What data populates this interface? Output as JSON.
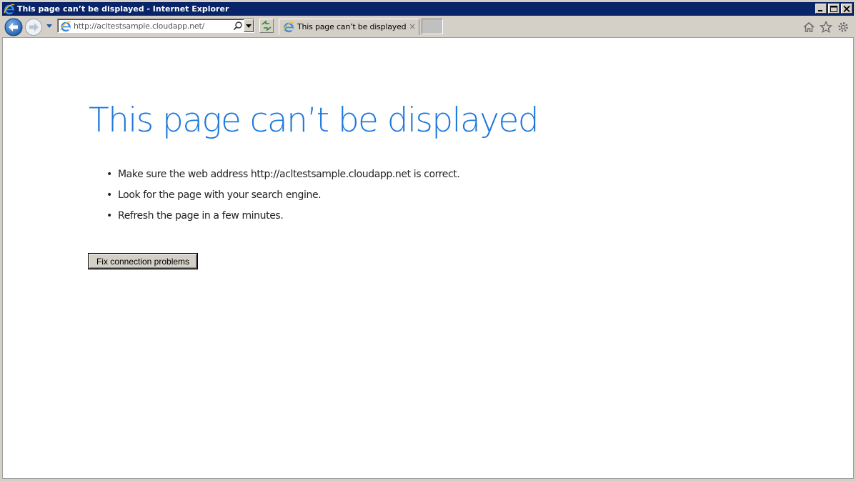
{
  "window": {
    "title": "This page can’t be displayed - Internet Explorer"
  },
  "toolbar": {
    "address": "http://acltestsample.cloudapp.net/",
    "tab_title": "This page can’t be displayed",
    "tab_close": "×",
    "icons": [
      "back-icon",
      "forward-icon",
      "history-dropdown-icon",
      "search-icon",
      "refresh-icon",
      "home-icon",
      "favorites-star-icon",
      "gear-icon"
    ]
  },
  "content": {
    "heading": "This page can’t be displayed",
    "bullet": "•",
    "items": [
      "Make sure the web address http://acltestsample.cloudapp.net is correct.",
      "Look for the page with your search engine.",
      "Refresh the page in a few minutes."
    ],
    "fix_button": "Fix connection problems"
  },
  "colors": {
    "titlebar": "#0a246a",
    "heading": "#1e78dc",
    "chrome": "#d4d0c8"
  }
}
